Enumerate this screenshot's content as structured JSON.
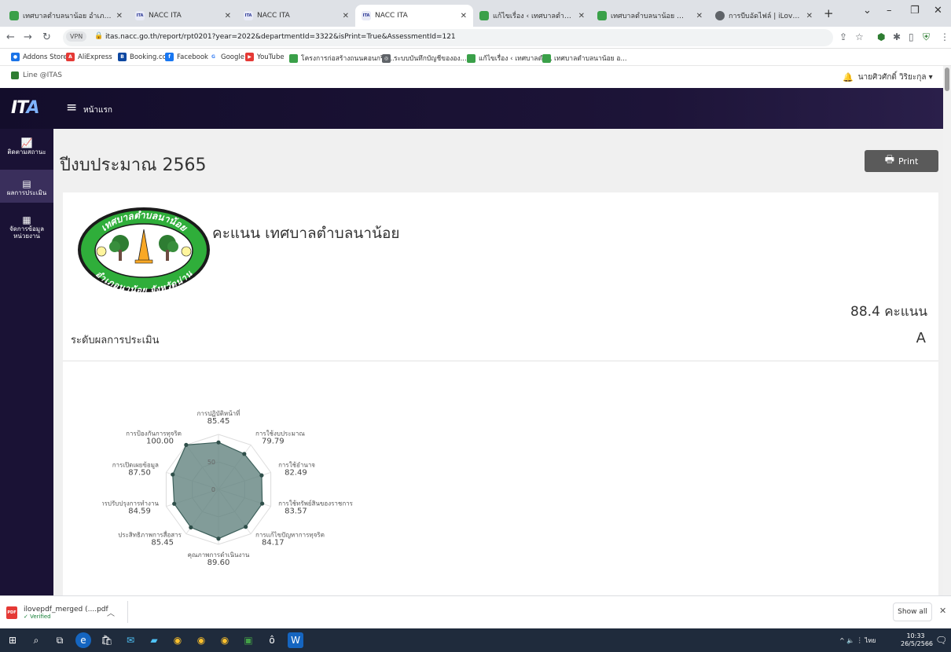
{
  "browser": {
    "tabs": [
      {
        "title": "เทศบาลตำบลนาน้อย อำเภอนาน้อย จ",
        "icon": "green-seal-icon",
        "active": false
      },
      {
        "title": "NACC ITA",
        "icon": "nacc-icon",
        "active": false
      },
      {
        "title": "NACC ITA",
        "icon": "nacc-icon",
        "active": false
      },
      {
        "title": "NACC ITA",
        "icon": "nacc-icon",
        "active": true
      },
      {
        "title": "แก้ไขเรื่อง ‹ เทศบาลตำบลนาน้อย อำ",
        "icon": "green-seal-icon",
        "active": false
      },
      {
        "title": "เทศบาลตำบลนาน้อย อำเภอนาน้อย จ",
        "icon": "green-seal-icon",
        "active": false
      },
      {
        "title": "การบีบอัดไฟล์ | iLovePDF",
        "icon": "globe-icon",
        "active": false
      }
    ],
    "new_tab": "+",
    "url": "itas.nacc.go.th/report/rpt0201?year=2022&departmentId=3322&isPrint=True&AssessmentId=121",
    "vpn_label": "VPN",
    "bookmarks": [
      {
        "label": "Addons Store",
        "icon": "addons-icon"
      },
      {
        "label": "AliExpress",
        "icon": "aliexpress-icon"
      },
      {
        "label": "Booking.com",
        "icon": "booking-icon"
      },
      {
        "label": "Facebook",
        "icon": "facebook-icon"
      },
      {
        "label": "Google",
        "icon": "google-icon"
      },
      {
        "label": "YouTube",
        "icon": "youtube-icon"
      },
      {
        "label": "โครงการก่อสร้างถนนคอนกรีต...",
        "icon": "green-seal-icon"
      },
      {
        "label": "ระบบบันทึกบัญชีขององ...",
        "icon": "globe-icon"
      },
      {
        "label": "แก้ไขเรื่อง ‹ เทศบาลตำ...",
        "icon": "green-seal-icon"
      },
      {
        "label": "เทศบาลตำบลนาน้อย อ...",
        "icon": "green-seal-icon"
      }
    ],
    "colors": {
      "tabbar": "#dee1e6",
      "accent_green": "#3aa049"
    }
  },
  "page": {
    "line_button": "Line @ITAS",
    "user_name": "นายศิวศักดิ์ วิริยะกุล ▾",
    "brand": {
      "part1": "IT",
      "part2": "A"
    },
    "home_link": "หน้าแรก",
    "sidebar": [
      {
        "label": "ติดตามสถานะ",
        "icon": "chart-icon",
        "active": false
      },
      {
        "label": "ผลการประเมิน",
        "icon": "document-icon",
        "active": true
      },
      {
        "label": "จัดการข้อมูลหน่วยงาน",
        "icon": "file-icon",
        "active": false
      }
    ],
    "title": "ปีงบประมาณ 2565",
    "print_label": "Print",
    "org_heading": "คะแนน เทศบาลตำบลนาน้อย",
    "logo_text_top": "เทศบาลตำบลนาน้อย",
    "logo_text_bottom": "อำเภอนาน้อย จังหวัดน่าน",
    "score_text": "88.4 คะแนน",
    "level_label": "ระดับผลการประเมิน",
    "level_value": "A",
    "colors": {
      "header": "#1a1235",
      "fill": "#5f807c",
      "main_bg": "#f0f0f0"
    }
  },
  "chart_data": {
    "type": "radar",
    "rlim": [
      0,
      100
    ],
    "ticks": [
      "0",
      "50"
    ],
    "categories": [
      "การปฏิบัติหน้าที่",
      "การใช้งบประมาณ",
      "การใช้อำนาจ",
      "การใช้ทรัพย์สินของราชการ",
      "การแก้ไขปัญหาการทุจริต",
      "คุณภาพการดำเนินงาน",
      "ประสิทธิภาพการสื่อสาร",
      "การปรับปรุงการทำงาน",
      "การเปิดเผยข้อมูล",
      "การป้องกันการทุจริต"
    ],
    "values": [
      85.45,
      79.79,
      82.49,
      83.57,
      84.17,
      89.6,
      85.45,
      84.59,
      87.5,
      100.0
    ],
    "value_labels": [
      "85.45",
      "79.79",
      "82.49",
      "83.57",
      "84.17",
      "89.60",
      "85.45",
      "84.59",
      "87.50",
      "100.00"
    ]
  },
  "downloads": {
    "file_name": "ilovepdf_merged (....pdf",
    "status": "✓ Verified",
    "show_all": "Show all"
  },
  "taskbar": {
    "tray": "^ 🔈 ︙ ไทย",
    "time": "10:33",
    "date": "26/5/2566"
  }
}
